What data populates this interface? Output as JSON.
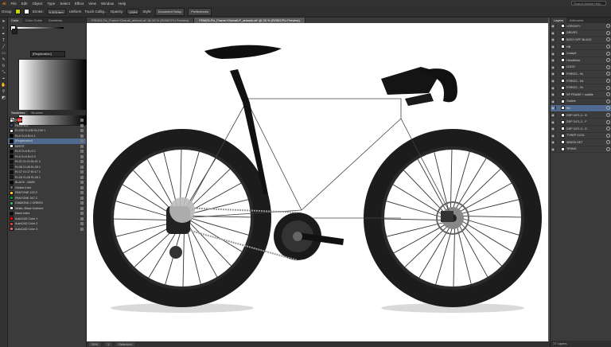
{
  "menubar": {
    "items": [
      "File",
      "Edit",
      "Object",
      "Type",
      "Select",
      "Effect",
      "View",
      "Window",
      "Help"
    ],
    "search_placeholder": "Search Adobe Help"
  },
  "control_bar": {
    "selection_label": "Group",
    "stroke_label": "Stroke:",
    "stroke_value": "0.303 mm",
    "stroke_style": "Uniform",
    "brush_label": "Touch Callig...",
    "opacity_label": "Opacity:",
    "opacity_value": "100%",
    "style_label": "Style:",
    "doc_setup_label": "Document Setup",
    "prefs_label": "Preferences"
  },
  "doc_tabs": [
    {
      "label": "FRM23-Fix_Frame+Overall_artwork.ai* @ 33 % (RGB/CPU Preview)",
      "active": false
    },
    {
      "label": "FRM23-Fix_Frame+Overall-P_artwork.ai* @ 25 % (RGB/CPU Preview)",
      "active": true
    }
  ],
  "left_panel": {
    "tabs": [
      "Color",
      "Color Guide",
      "Gradients"
    ],
    "registration_value": "[Registration]",
    "swatches_tabs": [
      "Swatches",
      "Brushes"
    ],
    "swatches": [
      {
        "name": "[None]",
        "color": "#ffffff"
      },
      {
        "name": "PACIFIC3",
        "color": "#3a4a6a"
      },
      {
        "name": "R=230 G=230 B=230 1",
        "color": "#e6e6e6"
      },
      {
        "name": "R=0 G=0 B=0 1",
        "color": "#000000"
      },
      {
        "name": "[Registration]",
        "color": "#000000",
        "selected": true
      },
      {
        "name": "WHITE",
        "color": "#ffffff"
      },
      {
        "name": "R=0 G=0 B=0 2",
        "color": "#000000"
      },
      {
        "name": "R=0 G=0 B=0 3",
        "color": "#000000"
      },
      {
        "name": "R=21 G=21 B=21 1",
        "color": "#151515"
      },
      {
        "name": "R=28 G=28 B=28 1",
        "color": "#1c1c1c"
      },
      {
        "name": "R=17 G=17 B=17 1",
        "color": "#111111"
      },
      {
        "name": "R=26 G=26 B=26 1",
        "color": "#1a1a1a"
      },
      {
        "name": "BLACK - MAIN",
        "color": "#050505"
      },
      {
        "name": "Global Color",
        "color": "#6a6a6a"
      },
      {
        "name": "PANTONE 123 C",
        "color": "#ffc72c"
      },
      {
        "name": "PANTONE 347 C",
        "color": "#009a44"
      },
      {
        "name": "DIAMOND 2 GREEN",
        "color": "#3fae6a"
      },
      {
        "name": "White, Black Outlined",
        "color": "#ffffff"
      },
      {
        "name": "black index",
        "color": "#0a0a0a"
      },
      {
        "name": "AutoCAD Color 1",
        "color": "#ff0000"
      },
      {
        "name": "AutoCAD Color 2",
        "color": "#d94040"
      },
      {
        "name": "AutoCAD Color 3",
        "color": "#e06a6a"
      }
    ]
  },
  "layers": [
    {
      "name": "<GROUP>",
      "selected": false
    },
    {
      "name": "DRIVES",
      "selected": false
    },
    {
      "name": "BODY DFF BLACK",
      "selected": false
    },
    {
      "name": "HB",
      "selected": false
    },
    {
      "name": "Cockpit",
      "selected": false
    },
    {
      "name": "Handlebar",
      "selected": false
    },
    {
      "name": "LOGO",
      "selected": false
    },
    {
      "name": "FSR023 - HL",
      "selected": false
    },
    {
      "name": "FSR023 - ML",
      "selected": false
    },
    {
      "name": "FSR023 - HL",
      "selected": false
    },
    {
      "name": "SP FRAME + saddle",
      "selected": false
    },
    {
      "name": "Outline",
      "selected": false
    },
    {
      "name": "fifo",
      "selected": true
    },
    {
      "name": "DSP 3471-3 - B",
      "selected": false
    },
    {
      "name": "DSP 3471-3 - F",
      "selected": false
    },
    {
      "name": "DSP 3471-3 - D",
      "selected": false
    },
    {
      "name": "TYREP XC33",
      "selected": false
    },
    {
      "name": "WHEELSET",
      "selected": false
    },
    {
      "name": "TIRING",
      "selected": false
    }
  ],
  "right_panel": {
    "tabs": [
      "Layers",
      "Artboards"
    ],
    "footer": "17 Layers"
  },
  "status": {
    "zoom": "25%",
    "artboard": "1",
    "tool": "Selection"
  },
  "colors": {
    "frame": "#111111",
    "tyre": "#1a1a1a",
    "rim": "#222222",
    "accent_sel": "#4f6a8e"
  }
}
